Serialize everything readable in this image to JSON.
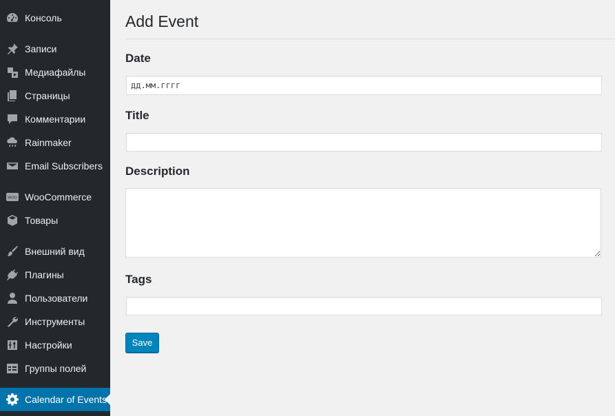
{
  "sidebar": {
    "items": [
      {
        "label": "Консоль",
        "icon": "dashboard-icon",
        "active": false
      },
      {
        "label": "Записи",
        "icon": "pin-icon",
        "active": false
      },
      {
        "label": "Медиафайлы",
        "icon": "media-icon",
        "active": false
      },
      {
        "label": "Страницы",
        "icon": "pages-icon",
        "active": false
      },
      {
        "label": "Комментарии",
        "icon": "comment-icon",
        "active": false
      },
      {
        "label": "Rainmaker",
        "icon": "cloud-rain-icon",
        "active": false
      },
      {
        "label": "Email Subscribers",
        "icon": "envelope-icon",
        "active": false
      },
      {
        "label": "WooCommerce",
        "icon": "woo-icon",
        "active": false
      },
      {
        "label": "Товары",
        "icon": "box-icon",
        "active": false
      },
      {
        "label": "Внешний вид",
        "icon": "paintbrush-icon",
        "active": false
      },
      {
        "label": "Плагины",
        "icon": "plug-icon",
        "active": false
      },
      {
        "label": "Пользователи",
        "icon": "user-icon",
        "active": false
      },
      {
        "label": "Инструменты",
        "icon": "wrench-icon",
        "active": false
      },
      {
        "label": "Настройки",
        "icon": "settings-sliders-icon",
        "active": false
      },
      {
        "label": "Группы полей",
        "icon": "table-icon",
        "active": false
      },
      {
        "label": "Calendar of Events",
        "icon": "gear-icon",
        "active": true
      }
    ]
  },
  "main": {
    "title": "Add Event",
    "form": {
      "date_label": "Date",
      "date_placeholder": "дд.мм.гггг",
      "title_label": "Title",
      "title_value": "",
      "description_label": "Description",
      "tags_label": "Tags",
      "tags_value": "",
      "save_label": "Save"
    }
  },
  "colors": {
    "sidebar_bg": "#23282d",
    "active_bg": "#0073aa",
    "button_bg": "#0085ba",
    "content_bg": "#f1f1f1"
  }
}
